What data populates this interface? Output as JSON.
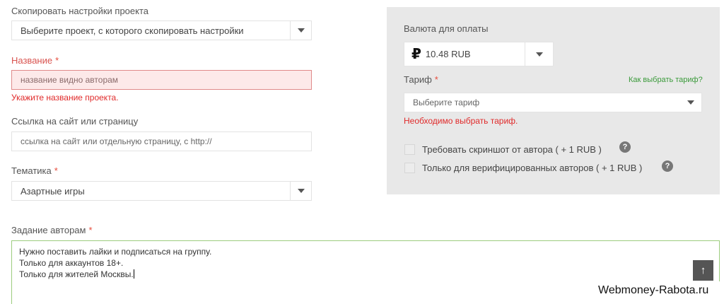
{
  "copy_settings": {
    "label": "Скопировать настройки проекта",
    "select_value": "Выберите проект, с которого скопировать настройки"
  },
  "name_field": {
    "label": "Название",
    "required_mark": "*",
    "placeholder": "название видно авторам",
    "error": "Укажите название проекта."
  },
  "site_link": {
    "label": "Ссылка на сайт или страницу",
    "placeholder": "ссылка на сайт или отдельную страницу, с http://"
  },
  "topic": {
    "label": "Тематика",
    "required_mark": "*",
    "select_value": "Азартные игры"
  },
  "task": {
    "label": "Задание авторам",
    "required_mark": "*",
    "lines": [
      "Нужно поставить лайки и подписаться на группу.",
      "Только для аккаунтов 18+.",
      "Только для жителей Москвы."
    ]
  },
  "payment": {
    "currency_label": "Валюта для оплаты",
    "currency_symbol": "₽",
    "currency_value": "10.48 RUB",
    "tariff_label": "Тариф",
    "required_mark": "*",
    "how_to_choose_link": "Как выбрать тариф?",
    "tariff_placeholder": "Выберите тариф",
    "tariff_error": "Необходимо выбрать тариф.",
    "options": [
      {
        "label": "Требовать скриншот от автора ( + 1 RUB )",
        "checked": false
      },
      {
        "label": "Только для верифицированных авторов ( + 1 RUB )",
        "checked": false
      }
    ]
  },
  "help_glyph": "?",
  "scroll_top_glyph": "↑",
  "watermark": "Webmoney-Rabota.ru",
  "colors": {
    "error": "#e02a2a",
    "required": "#e74c3c",
    "link": "#3a9a3a",
    "panel_bg": "#e8e8e8",
    "textarea_border": "#9ccc7e"
  }
}
